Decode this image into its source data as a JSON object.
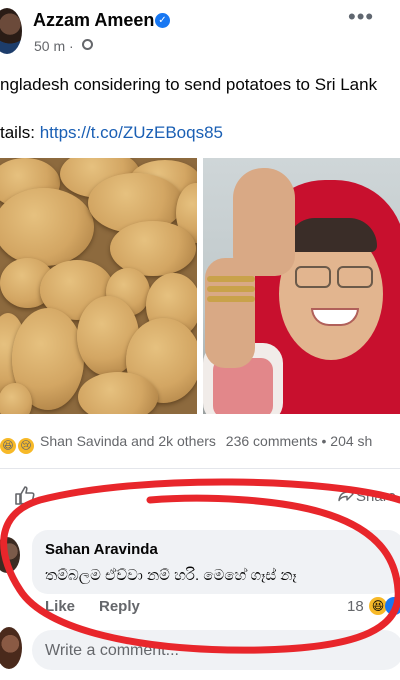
{
  "post": {
    "author": "Azzam Ameen",
    "time": "50 m ·",
    "text": "ngladesh considering to send potatoes to Sri Lank",
    "details_prefix": "tails: ",
    "details_link": "https://t.co/ZUzEBoqs85"
  },
  "icons": {
    "more": "more-options-icon",
    "verified": "verified-badge-icon",
    "audience": "globe-icon",
    "like": "thumbs-up-icon",
    "share": "share-icon"
  },
  "engagement": {
    "reactions_text": "Shan Savinda and 2k others",
    "comments_text": "236 comments • 204 sh"
  },
  "actions": {
    "share_label": "Share"
  },
  "comment": {
    "author": "Sahan Aravinda",
    "text": "තම්බලම ඒව්වා නම් හරි. මෙහේ ගෑස් නෑ",
    "like_label": "Like",
    "reply_label": "Reply",
    "reaction_count": "18"
  },
  "composer": {
    "placeholder": "Write a comment..."
  },
  "colors": {
    "link": "#1a5fb4",
    "annotation": "#e8262b",
    "muted": "#65676b"
  }
}
